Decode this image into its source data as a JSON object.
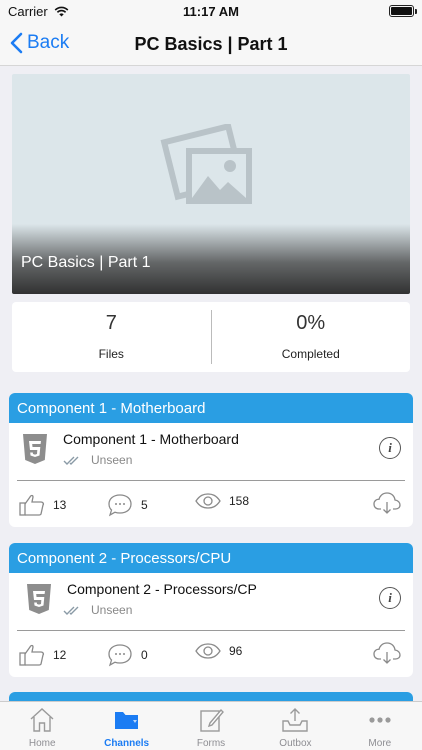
{
  "status_bar": {
    "carrier": "Carrier",
    "time": "11:17 AM"
  },
  "nav": {
    "back_label": "Back",
    "title": "PC Basics | Part 1"
  },
  "hero": {
    "title": "PC Basics | Part 1"
  },
  "stats": {
    "files_value": "7",
    "files_label": "Files",
    "completed_value": "0%",
    "completed_label": "Completed"
  },
  "cards": [
    {
      "header": "Component 1 - Motherboard",
      "title": "Component 1 - Motherboard",
      "status": "Unseen",
      "likes": "13",
      "comments": "5",
      "views": "158"
    },
    {
      "header": "Component 2 - Processors/CPU",
      "title": "Component 2 - Processors/CP",
      "status": "Unseen",
      "likes": "12",
      "comments": "0",
      "views": "96"
    }
  ],
  "tab_bar": {
    "items": [
      {
        "label": "Home",
        "icon": "home-icon"
      },
      {
        "label": "Channels",
        "icon": "folder-icon",
        "active": true
      },
      {
        "label": "Forms",
        "icon": "form-edit-icon"
      },
      {
        "label": "Outbox",
        "icon": "outbox-icon"
      },
      {
        "label": "More",
        "icon": "more-icon"
      }
    ]
  },
  "colors": {
    "accent": "#1b7cf3",
    "card_header": "#2a9ee3"
  }
}
